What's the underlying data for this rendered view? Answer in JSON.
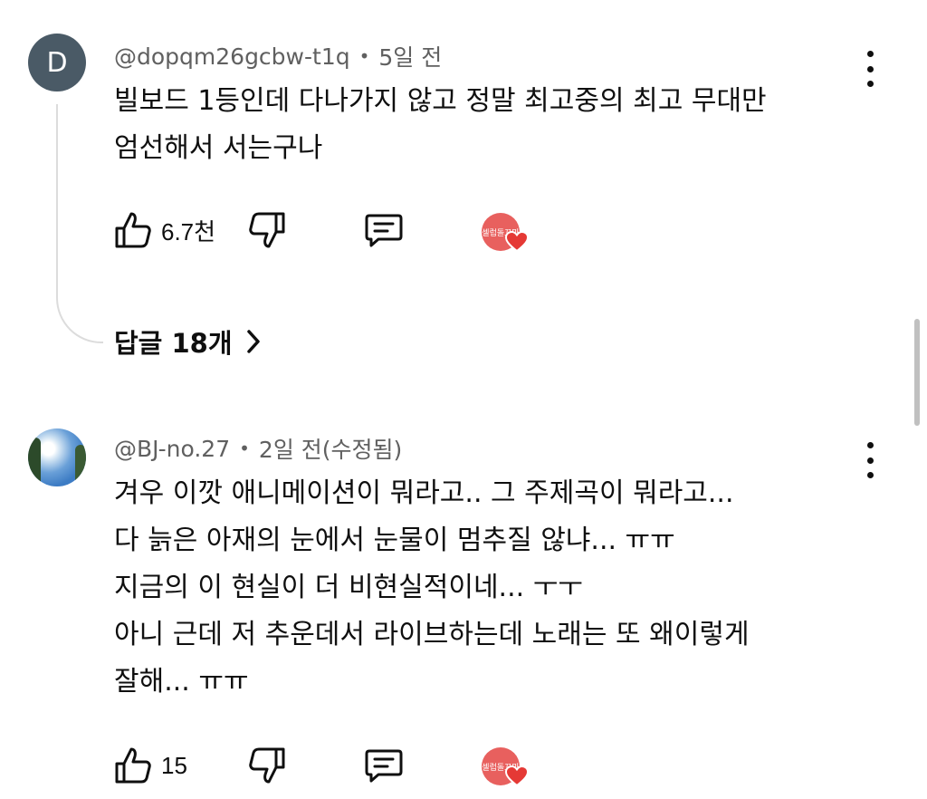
{
  "comments": [
    {
      "avatar_letter": "D",
      "avatar_color": "#4a5a66",
      "author": "@dopqm26gcbw-t1q",
      "separator": "•",
      "time": "5일 전",
      "lines": [
        "빌보드 1등인데 다나가지 않고 정말 최고중의 최고 무대만",
        "엄선해서 서는구나"
      ],
      "like_count": "6.7천",
      "creator_heart_badge": "셀럽돌꼬마",
      "replies_label": "답글 18개"
    },
    {
      "author": "@BJ-no.27",
      "separator": "•",
      "time": "2일 전(수정됨)",
      "lines": [
        "겨우 이깟 애니메이션이 뭐라고.. 그 주제곡이 뭐라고...",
        "다 늙은 아재의 눈에서 눈물이 멈추질 않냐... ㅠㅠ",
        "지금의 이 현실이 더 비현실적이네... ㅜㅜ",
        "아니 근데 저 추운데서 라이브하는데 노래는 또 왜이렇게",
        "잘해... ㅠㅠ"
      ],
      "like_count": "15",
      "creator_heart_badge": "셀럽돌꼬마"
    }
  ],
  "colors": {
    "text": "#0f0f0f",
    "meta": "#606060",
    "heart": "#e53935",
    "badge": "#e8605e"
  },
  "icons": [
    "like-icon",
    "dislike-icon",
    "reply-icon",
    "more-vert-icon",
    "chevron-right-icon",
    "heart-icon"
  ]
}
